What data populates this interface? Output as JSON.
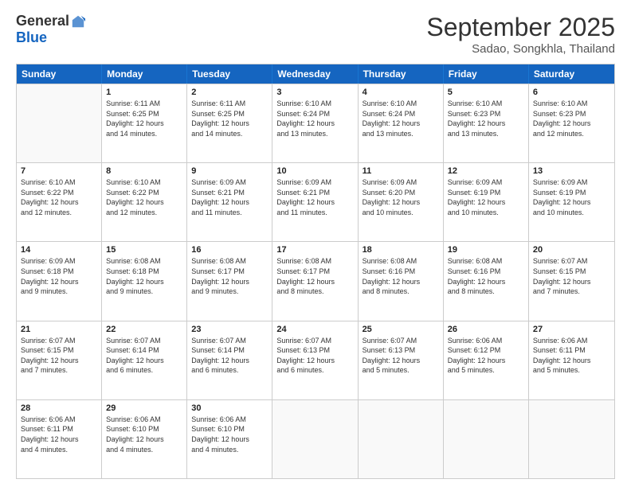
{
  "logo": {
    "general": "General",
    "blue": "Blue"
  },
  "title": "September 2025",
  "subtitle": "Sadao, Songkhla, Thailand",
  "days": [
    "Sunday",
    "Monday",
    "Tuesday",
    "Wednesday",
    "Thursday",
    "Friday",
    "Saturday"
  ],
  "weeks": [
    [
      {
        "day": "",
        "info": ""
      },
      {
        "day": "1",
        "info": "Sunrise: 6:11 AM\nSunset: 6:25 PM\nDaylight: 12 hours\nand 14 minutes."
      },
      {
        "day": "2",
        "info": "Sunrise: 6:11 AM\nSunset: 6:25 PM\nDaylight: 12 hours\nand 14 minutes."
      },
      {
        "day": "3",
        "info": "Sunrise: 6:10 AM\nSunset: 6:24 PM\nDaylight: 12 hours\nand 13 minutes."
      },
      {
        "day": "4",
        "info": "Sunrise: 6:10 AM\nSunset: 6:24 PM\nDaylight: 12 hours\nand 13 minutes."
      },
      {
        "day": "5",
        "info": "Sunrise: 6:10 AM\nSunset: 6:23 PM\nDaylight: 12 hours\nand 13 minutes."
      },
      {
        "day": "6",
        "info": "Sunrise: 6:10 AM\nSunset: 6:23 PM\nDaylight: 12 hours\nand 12 minutes."
      }
    ],
    [
      {
        "day": "7",
        "info": "Sunrise: 6:10 AM\nSunset: 6:22 PM\nDaylight: 12 hours\nand 12 minutes."
      },
      {
        "day": "8",
        "info": "Sunrise: 6:10 AM\nSunset: 6:22 PM\nDaylight: 12 hours\nand 12 minutes."
      },
      {
        "day": "9",
        "info": "Sunrise: 6:09 AM\nSunset: 6:21 PM\nDaylight: 12 hours\nand 11 minutes."
      },
      {
        "day": "10",
        "info": "Sunrise: 6:09 AM\nSunset: 6:21 PM\nDaylight: 12 hours\nand 11 minutes."
      },
      {
        "day": "11",
        "info": "Sunrise: 6:09 AM\nSunset: 6:20 PM\nDaylight: 12 hours\nand 10 minutes."
      },
      {
        "day": "12",
        "info": "Sunrise: 6:09 AM\nSunset: 6:19 PM\nDaylight: 12 hours\nand 10 minutes."
      },
      {
        "day": "13",
        "info": "Sunrise: 6:09 AM\nSunset: 6:19 PM\nDaylight: 12 hours\nand 10 minutes."
      }
    ],
    [
      {
        "day": "14",
        "info": "Sunrise: 6:09 AM\nSunset: 6:18 PM\nDaylight: 12 hours\nand 9 minutes."
      },
      {
        "day": "15",
        "info": "Sunrise: 6:08 AM\nSunset: 6:18 PM\nDaylight: 12 hours\nand 9 minutes."
      },
      {
        "day": "16",
        "info": "Sunrise: 6:08 AM\nSunset: 6:17 PM\nDaylight: 12 hours\nand 9 minutes."
      },
      {
        "day": "17",
        "info": "Sunrise: 6:08 AM\nSunset: 6:17 PM\nDaylight: 12 hours\nand 8 minutes."
      },
      {
        "day": "18",
        "info": "Sunrise: 6:08 AM\nSunset: 6:16 PM\nDaylight: 12 hours\nand 8 minutes."
      },
      {
        "day": "19",
        "info": "Sunrise: 6:08 AM\nSunset: 6:16 PM\nDaylight: 12 hours\nand 8 minutes."
      },
      {
        "day": "20",
        "info": "Sunrise: 6:07 AM\nSunset: 6:15 PM\nDaylight: 12 hours\nand 7 minutes."
      }
    ],
    [
      {
        "day": "21",
        "info": "Sunrise: 6:07 AM\nSunset: 6:15 PM\nDaylight: 12 hours\nand 7 minutes."
      },
      {
        "day": "22",
        "info": "Sunrise: 6:07 AM\nSunset: 6:14 PM\nDaylight: 12 hours\nand 6 minutes."
      },
      {
        "day": "23",
        "info": "Sunrise: 6:07 AM\nSunset: 6:14 PM\nDaylight: 12 hours\nand 6 minutes."
      },
      {
        "day": "24",
        "info": "Sunrise: 6:07 AM\nSunset: 6:13 PM\nDaylight: 12 hours\nand 6 minutes."
      },
      {
        "day": "25",
        "info": "Sunrise: 6:07 AM\nSunset: 6:13 PM\nDaylight: 12 hours\nand 5 minutes."
      },
      {
        "day": "26",
        "info": "Sunrise: 6:06 AM\nSunset: 6:12 PM\nDaylight: 12 hours\nand 5 minutes."
      },
      {
        "day": "27",
        "info": "Sunrise: 6:06 AM\nSunset: 6:11 PM\nDaylight: 12 hours\nand 5 minutes."
      }
    ],
    [
      {
        "day": "28",
        "info": "Sunrise: 6:06 AM\nSunset: 6:11 PM\nDaylight: 12 hours\nand 4 minutes."
      },
      {
        "day": "29",
        "info": "Sunrise: 6:06 AM\nSunset: 6:10 PM\nDaylight: 12 hours\nand 4 minutes."
      },
      {
        "day": "30",
        "info": "Sunrise: 6:06 AM\nSunset: 6:10 PM\nDaylight: 12 hours\nand 4 minutes."
      },
      {
        "day": "",
        "info": ""
      },
      {
        "day": "",
        "info": ""
      },
      {
        "day": "",
        "info": ""
      },
      {
        "day": "",
        "info": ""
      }
    ]
  ]
}
